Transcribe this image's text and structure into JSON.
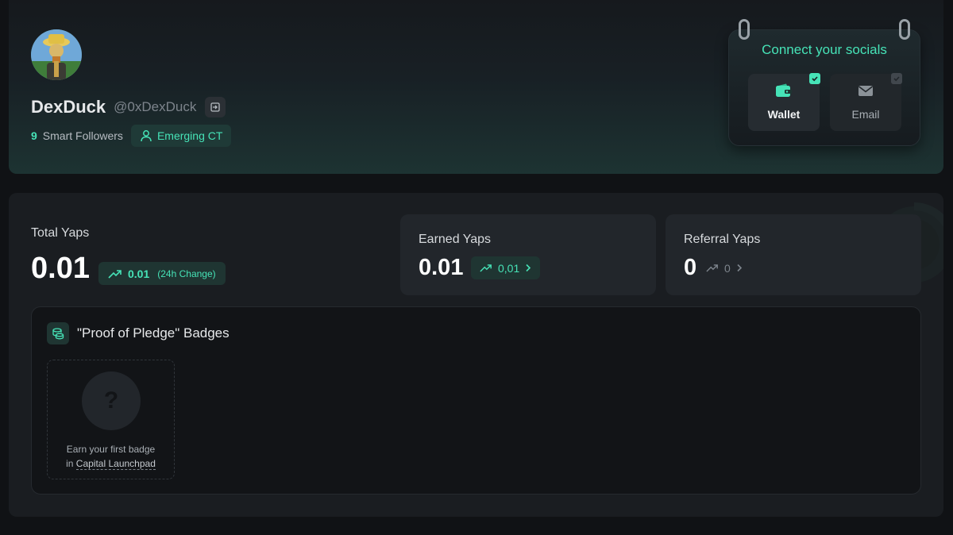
{
  "profile": {
    "display_name": "DexDuck",
    "handle": "@0xDexDuck",
    "smart_followers_count": "9",
    "smart_followers_label": "Smart Followers",
    "tag": "Emerging CT"
  },
  "socials": {
    "title": "Connect your socials",
    "items": [
      {
        "label": "Wallet",
        "icon": "wallet-icon",
        "connected": true
      },
      {
        "label": "Email",
        "icon": "mail-icon",
        "connected": false
      }
    ]
  },
  "yaps": {
    "total_label": "Total Yaps",
    "total_value": "0.01",
    "total_change": "0.01",
    "total_change_note": "(24h Change)",
    "earned_label": "Earned Yaps",
    "earned_value": "0.01",
    "earned_change": "0,01",
    "referral_label": "Referral Yaps",
    "referral_value": "0",
    "referral_change": "0"
  },
  "badges": {
    "title": "\"Proof of Pledge\" Badges",
    "placeholder_symbol": "?",
    "empty_line1": "Earn your first badge",
    "empty_line2_prefix": "in",
    "empty_link": "Capital Launchpad"
  },
  "colors": {
    "accent": "#46e3b7",
    "background": "#101215",
    "panel": "#1a1d21",
    "card": "#22262b"
  }
}
